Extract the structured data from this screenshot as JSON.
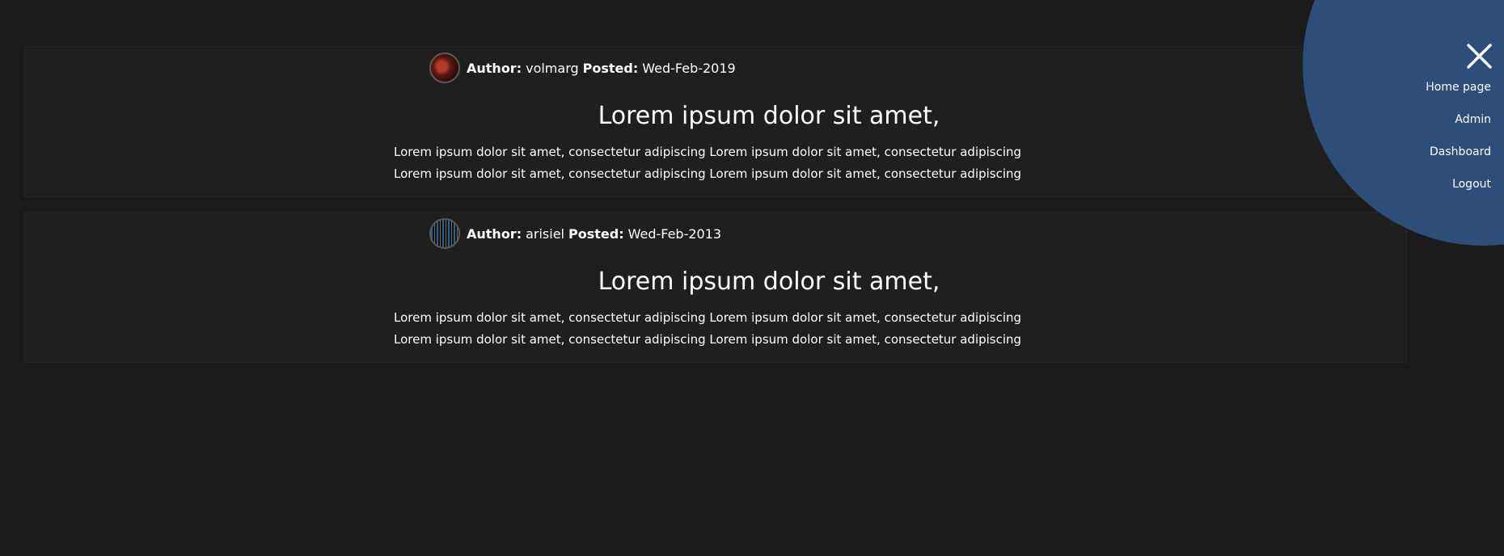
{
  "posts": [
    {
      "author_label": "Author:",
      "author": "volmarg",
      "posted_label": "Posted:",
      "posted": "Wed-Feb-2019",
      "title": "Lorem ipsum dolor sit amet,",
      "body": "Lorem ipsum dolor sit amet, consectetur adipiscing Lorem ipsum dolor sit amet, consectetur adipiscing Lorem ipsum dolor sit amet, consectetur adipiscing Lorem ipsum dolor sit amet, consectetur adipiscing"
    },
    {
      "author_label": "Author:",
      "author": "arisiel",
      "posted_label": "Posted:",
      "posted": "Wed-Feb-2013",
      "title": "Lorem ipsum dolor sit amet,",
      "body": "Lorem ipsum dolor sit amet, consectetur adipiscing Lorem ipsum dolor sit amet, consectetur adipiscing Lorem ipsum dolor sit amet, consectetur adipiscing Lorem ipsum dolor sit amet, consectetur adipiscing"
    }
  ],
  "menu": {
    "close_icon": "close-icon",
    "items": [
      {
        "label": "Home page"
      },
      {
        "label": "Admin"
      },
      {
        "label": "Dashboard"
      },
      {
        "label": "Logout"
      }
    ]
  },
  "colors": {
    "background": "#1b1b1b",
    "card": "#1f1f1f",
    "menu_circle": "#2c4e79",
    "text": "#ffffff"
  }
}
